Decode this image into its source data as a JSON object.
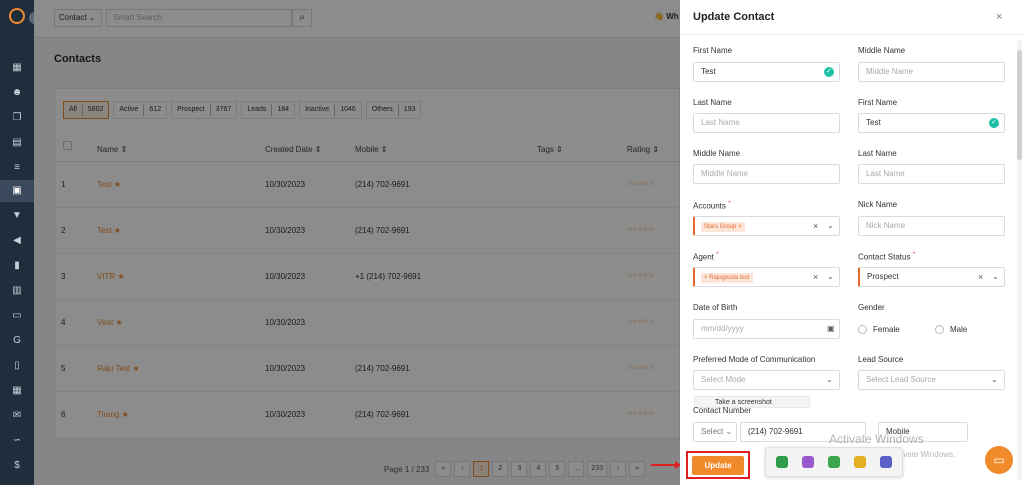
{
  "topbar": {
    "select_value": "Contact",
    "search_placeholder": "Smart Search",
    "user_short": "Wh"
  },
  "page_title": "Contacts",
  "filters": [
    {
      "label": "All",
      "count": "5802"
    },
    {
      "label": "Active",
      "count": "612"
    },
    {
      "label": "Prospect",
      "count": "3767"
    },
    {
      "label": "Leads",
      "count": "184"
    },
    {
      "label": "Inactive",
      "count": "1046"
    },
    {
      "label": "Others",
      "count": "193"
    }
  ],
  "table": {
    "headers": {
      "name": "Name ⇕",
      "created": "Created Date ⇕",
      "mobile": "Mobile ⇕",
      "tags": "Tags ⇕",
      "rating": "Rating ⇕"
    },
    "rows": [
      {
        "num": "1",
        "name": "Test",
        "date": "10/30/2023",
        "mobile": "(214) 702-9691",
        "rating": "☆☆☆☆☆"
      },
      {
        "num": "2",
        "name": "Test",
        "date": "10/30/2023",
        "mobile": "(214) 702-9691",
        "rating": "☆☆☆☆☆"
      },
      {
        "num": "3",
        "name": "VITR",
        "date": "10/30/2023",
        "mobile": "+1 (214) 702-9691",
        "rating": "☆☆☆☆☆"
      },
      {
        "num": "4",
        "name": "Virat",
        "date": "10/30/2023",
        "mobile": "",
        "rating": "☆☆☆☆☆"
      },
      {
        "num": "5",
        "name": "Raju Test",
        "date": "10/30/2023",
        "mobile": "(214) 702-9691",
        "rating": "☆☆☆☆☆"
      },
      {
        "num": "6",
        "name": "Tirang",
        "date": "10/30/2023",
        "mobile": "(214) 702-9691",
        "rating": "☆☆☆☆☆"
      }
    ]
  },
  "pagination": {
    "label": "Page 1 / 233",
    "first": "«",
    "prev": "‹",
    "pages": [
      "1",
      "2",
      "3",
      "4",
      "5",
      "...",
      "233"
    ],
    "next": "›",
    "last": "»"
  },
  "panel": {
    "title": "Update Contact",
    "close": "×",
    "first_name_label": "First Name",
    "first_name_value": "Test",
    "middle_name_label": "Middle Name",
    "middle_name_placeholder": "Middle Name",
    "last_name_label": "Last Name",
    "last_name_placeholder": "Last Name",
    "first_name2_label": "First Name",
    "first_name2_value": "Test",
    "middle_name2_label": "Middle Name",
    "middle_name2_placeholder": "Middle Name",
    "last_name2_label": "Last Name",
    "last_name2_placeholder": "Last Name",
    "accounts_label": "Accounts",
    "accounts_tag": "Stars Group",
    "nick_name_label": "Nick Name",
    "nick_name_placeholder": "Nick Name",
    "agent_label": "Agent",
    "agent_tag": "Rajugouda test",
    "status_label": "Contact Status",
    "status_value": "Prospect",
    "dob_label": "Date of Birth",
    "dob_placeholder": "mm/dd/yyyy",
    "gender_label": "Gender",
    "gender_female": "Female",
    "gender_male": "Male",
    "comm_label": "Preferred Mode of Communication",
    "comm_placeholder": "Select Mode",
    "lead_label": "Lead Source",
    "lead_placeholder": "Select Lead Source",
    "tooltip": "Take a screenshot",
    "contact_number_label": "Contact Number",
    "contact_select": "Select",
    "contact_value": "(214) 702-9691",
    "contact_type": "Mobile",
    "update_button": "Update",
    "required": "*",
    "remove": "×",
    "dropdown": "⌄",
    "check": "✓",
    "calendar": "▣"
  },
  "watermark": {
    "line1": "Activate Windows",
    "line2": "Go to Settings to activate Windows."
  },
  "taskbar_icons": [
    "shield-icon",
    "pen-icon",
    "recycle-icon",
    "security-icon",
    "teams-icon"
  ],
  "colors": {
    "accent": "#f08a2a",
    "sidebar": "#1f2d3d",
    "highlight": "#e02020",
    "success": "#1fbfa6"
  }
}
